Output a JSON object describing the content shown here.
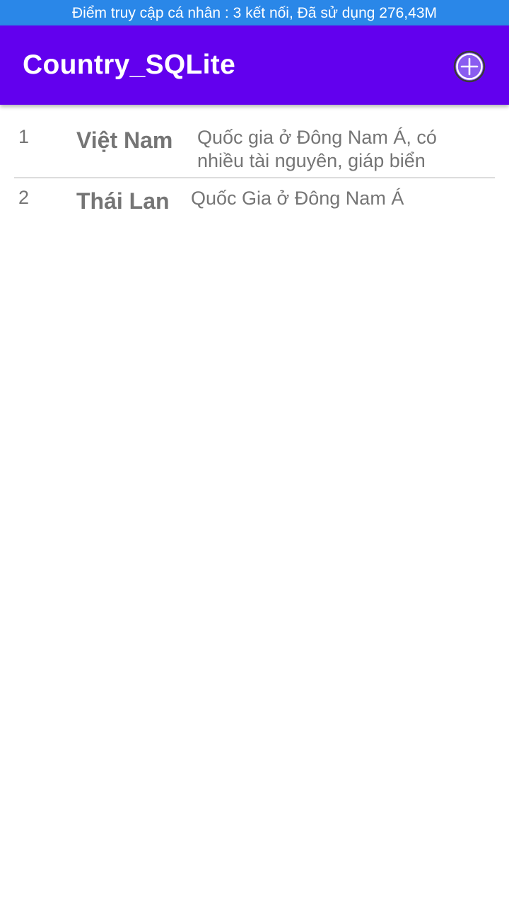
{
  "status_bar": {
    "text": "Điểm truy cập cá nhân : 3 kết nối, Đã sử dụng 276,43M",
    "color": "#2a87e8"
  },
  "app_bar": {
    "title": "Country_SQLite",
    "color": "#6200ee",
    "action_icon": "add-circle-icon"
  },
  "countries": [
    {
      "id": "1",
      "name": "Việt Nam",
      "description": "Quốc gia ở Đông Nam Á, có nhiều tài nguyên, giáp biển"
    },
    {
      "id": "2",
      "name": "Thái Lan",
      "description": "Quốc Gia ở Đông Nam Á"
    }
  ]
}
